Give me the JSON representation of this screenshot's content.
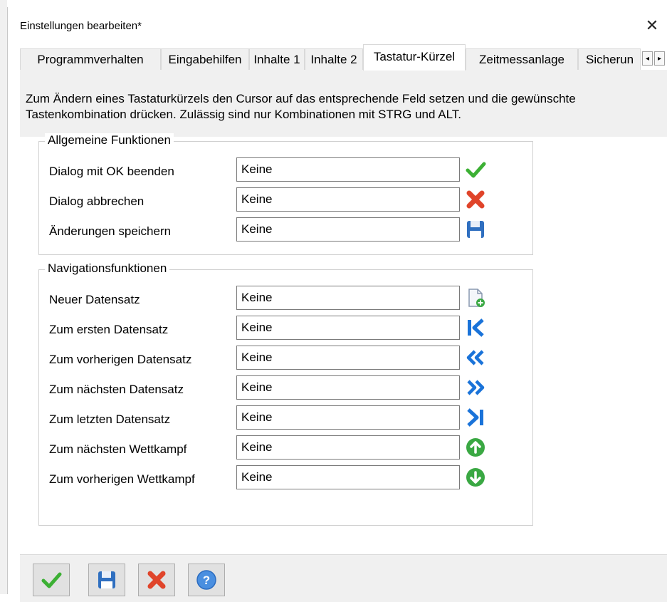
{
  "window": {
    "title": "Einstellungen bearbeiten*",
    "close_glyph": "✕"
  },
  "tabs": [
    {
      "label": "Programmverhalten",
      "active": false
    },
    {
      "label": "Eingabehilfen",
      "active": false
    },
    {
      "label": "Inhalte 1",
      "active": false
    },
    {
      "label": "Inhalte 2",
      "active": false
    },
    {
      "label": "Tastatur-Kürzel",
      "active": true
    },
    {
      "label": "Zeitmessanlage",
      "active": false
    },
    {
      "label": "Sicherun",
      "active": false
    }
  ],
  "tab_scroll": {
    "left_glyph": "◂",
    "right_glyph": "▸"
  },
  "info_text": "Zum Ändern eines Tastaturkürzels den Cursor auf das entsprechende Feld setzen und die gewünschte Tastenkombination drücken. Zulässig sind nur Kombinationen mit STRG und ALT.",
  "general": {
    "title": "Allgemeine Funktionen",
    "rows": [
      {
        "label": "Dialog mit OK beenden",
        "value": "Keine",
        "icon": "check-icon"
      },
      {
        "label": "Dialog abbrechen",
        "value": "Keine",
        "icon": "cancel-x-icon"
      },
      {
        "label": "Änderungen speichern",
        "value": "Keine",
        "icon": "save-disk-icon"
      }
    ]
  },
  "navigation": {
    "title": "Navigationsfunktionen",
    "rows": [
      {
        "label": "Neuer Datensatz",
        "value": "Keine",
        "icon": "new-record-icon"
      },
      {
        "label": "Zum ersten Datensatz",
        "value": "Keine",
        "icon": "first-record-icon"
      },
      {
        "label": "Zum vorherigen Datensatz",
        "value": "Keine",
        "icon": "previous-record-icon"
      },
      {
        "label": "Zum nächsten Datensatz",
        "value": "Keine",
        "icon": "next-record-icon"
      },
      {
        "label": "Zum letzten Datensatz",
        "value": "Keine",
        "icon": "last-record-icon"
      },
      {
        "label": "Zum nächsten Wettkampf",
        "value": "Keine",
        "icon": "up-arrow-circle-icon"
      },
      {
        "label": "Zum vorherigen Wettkampf",
        "value": "Keine",
        "icon": "down-arrow-circle-icon"
      }
    ]
  },
  "footer_buttons": [
    {
      "name": "ok-button",
      "icon": "check-icon"
    },
    {
      "name": "save-button",
      "icon": "save-disk-icon"
    },
    {
      "name": "cancel-button",
      "icon": "cancel-x-icon"
    },
    {
      "name": "help-button",
      "icon": "help-icon"
    }
  ],
  "colors": {
    "check_green": "#3cb034",
    "cancel_red": "#e0442a",
    "save_blue": "#2f6fc0",
    "nav_blue": "#1a73d9",
    "circle_green": "#3aa843",
    "help_blue": "#4a8fe0"
  }
}
